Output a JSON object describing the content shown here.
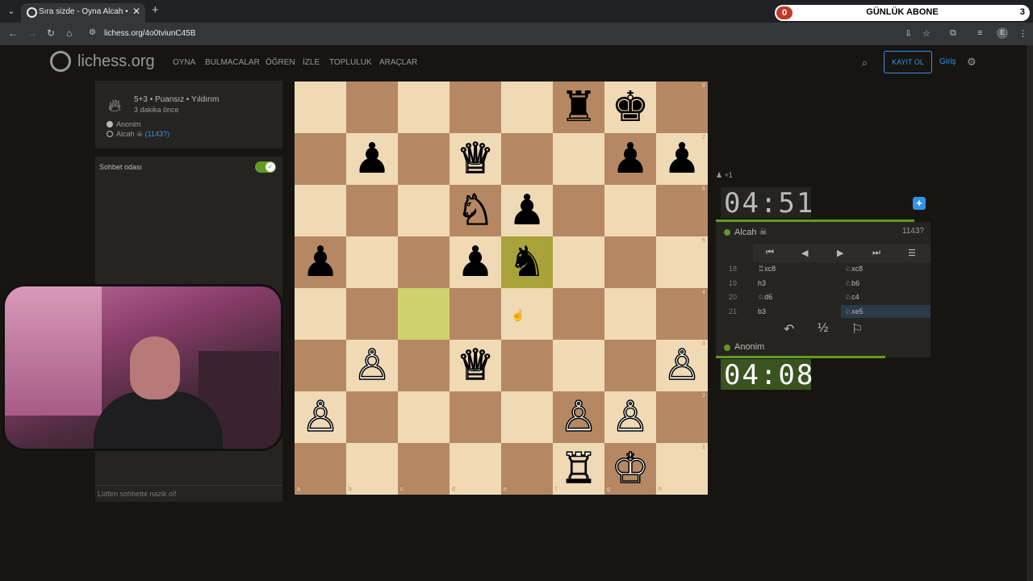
{
  "browser": {
    "tab_title": "Sıra sizde - Oyna Alcah • lichess",
    "url": "lichess.org/4o0tviunC45B",
    "tab_close": "✕",
    "new_tab": "+"
  },
  "overlay": {
    "left_count": "0",
    "title": "GÜNLÜK ABONE",
    "right_count": "3"
  },
  "site": {
    "logo": "lichess.org",
    "nav": [
      "OYNA",
      "BULMACALAR",
      "ÖĞREN",
      "İZLE",
      "TOPLULUK",
      "ARAÇLAR"
    ],
    "signup": "KAYIT OL",
    "login": "Giriş"
  },
  "game_meta": {
    "title": "5+3 • Puansız • Yıldırım",
    "time_ago": "3 dakika önce",
    "white_player": "Anonim",
    "black_player": "Alcah ☠",
    "black_rating": "(1143?)"
  },
  "chat": {
    "header": "Sohbet odası",
    "placeholder": "Lütfen sohbette nazik ol!"
  },
  "board": {
    "highlight": [
      "c4",
      "e5"
    ],
    "pieces": [
      {
        "sq": "f8",
        "p": "♜",
        "c": "b"
      },
      {
        "sq": "g8",
        "p": "♚",
        "c": "b"
      },
      {
        "sq": "b7",
        "p": "♟",
        "c": "b"
      },
      {
        "sq": "d7",
        "p": "♕",
        "c": "w"
      },
      {
        "sq": "g7",
        "p": "♟",
        "c": "b"
      },
      {
        "sq": "h7",
        "p": "♟",
        "c": "b"
      },
      {
        "sq": "d6",
        "p": "♘",
        "c": "w"
      },
      {
        "sq": "e6",
        "p": "♟",
        "c": "b"
      },
      {
        "sq": "a5",
        "p": "♟",
        "c": "b"
      },
      {
        "sq": "d5",
        "p": "♟",
        "c": "b"
      },
      {
        "sq": "e5",
        "p": "♞",
        "c": "b"
      },
      {
        "sq": "b3",
        "p": "♙",
        "c": "w"
      },
      {
        "sq": "d3",
        "p": "♕",
        "c": "w"
      },
      {
        "sq": "h3",
        "p": "♙",
        "c": "w"
      },
      {
        "sq": "a2",
        "p": "♙",
        "c": "w"
      },
      {
        "sq": "f2",
        "p": "♙",
        "c": "w"
      },
      {
        "sq": "g2",
        "p": "♙",
        "c": "w"
      },
      {
        "sq": "f1",
        "p": "♖",
        "c": "w"
      },
      {
        "sq": "g1",
        "p": "♔",
        "c": "w"
      }
    ],
    "files": [
      "a",
      "b",
      "c",
      "d",
      "e",
      "f",
      "g",
      "h"
    ],
    "ranks": [
      "8",
      "7",
      "6",
      "5",
      "4",
      "3",
      "2",
      "1"
    ]
  },
  "clocks": {
    "top": "04:51",
    "bottom": "04:08",
    "material": "+1"
  },
  "panel": {
    "top_player": "Alcah ☠",
    "top_rating": "1143?",
    "bottom_player": "Anonim",
    "controls": [
      "⏮",
      "◀",
      "▶",
      "⏭",
      "☰"
    ],
    "moves": [
      {
        "n": "18",
        "w": "♖xc8",
        "b": "♘xc8"
      },
      {
        "n": "19",
        "w": "h3",
        "b": "♘b6"
      },
      {
        "n": "20",
        "w": "♘d6",
        "b": "♘c4"
      },
      {
        "n": "21",
        "w": "b3",
        "b": "♘xe5"
      }
    ],
    "actions": [
      "↶",
      "½",
      "⚐"
    ]
  }
}
